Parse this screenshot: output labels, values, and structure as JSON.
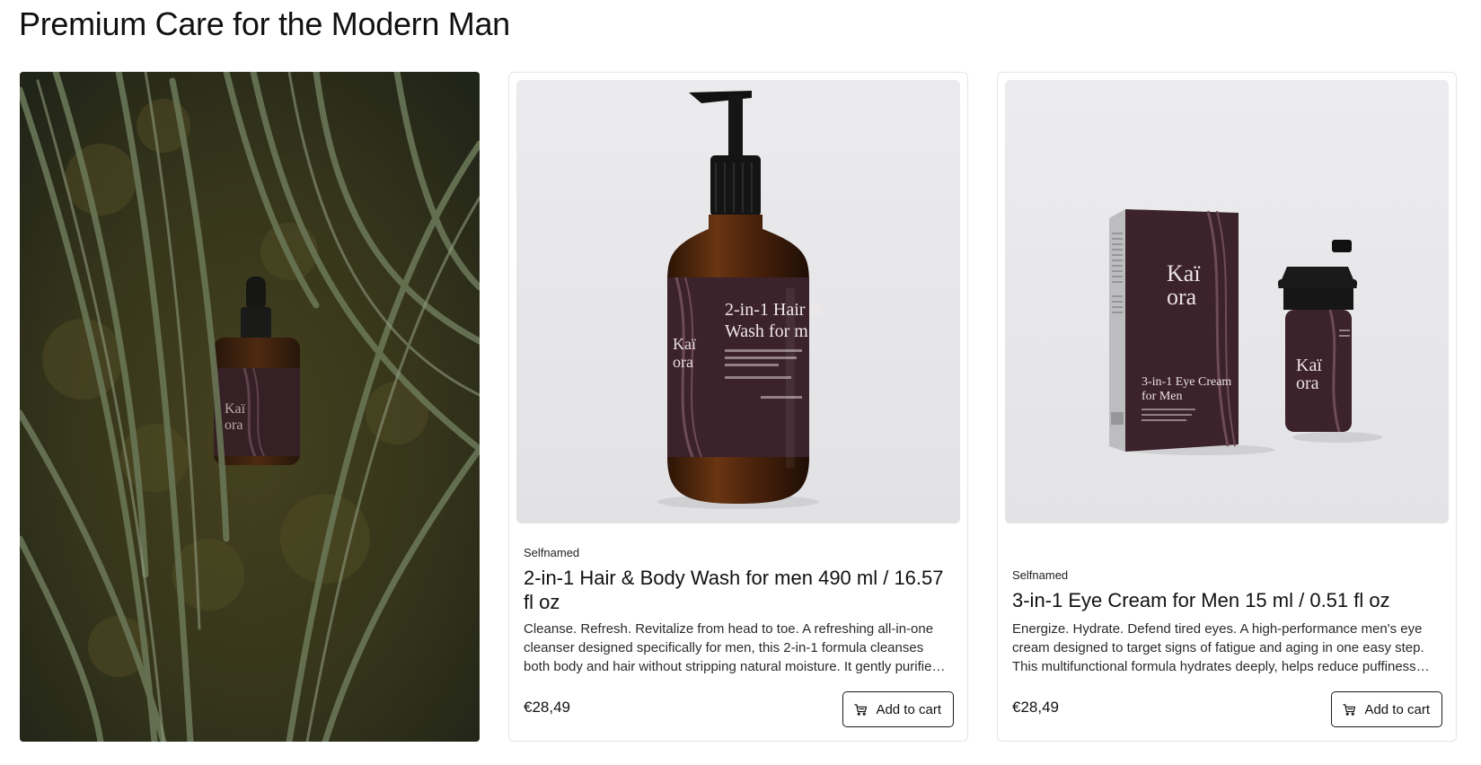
{
  "page": {
    "title": "Premium Care for the Modern Man"
  },
  "hero": {
    "label_brand": "Kaï",
    "label_brand2": "ora"
  },
  "products": [
    {
      "brand": "Selfnamed",
      "name": "2-in-1 Hair & Body Wash for men 490 ml / 16.57 fl oz",
      "description": "Cleanse. Refresh. Revitalize from head to toe. A refreshing all-in-one cleanser designed specifically for men, this 2-in-1 formula cleanses both body and hair without stripping natural moisture. It gently purifies the skin and scalp while leaving a fresh feeling.",
      "price": "€28,49",
      "button_label": "Add to cart",
      "button_icon": "cart-icon",
      "image_label_line1": "2-in-1 Hair &",
      "image_label_line2": "Wash for m"
    },
    {
      "brand": "Selfnamed",
      "name": "3-in-1 Eye Cream for Men 15 ml / 0.51 fl oz",
      "description": "Energize. Hydrate. Defend tired eyes. A high-performance men's eye cream designed to target signs of fatigue and aging in one easy step. This multifunctional formula hydrates deeply, helps reduce puffiness and dark circles.",
      "price": "€28,49",
      "button_label": "Add to cart",
      "button_icon": "cart-icon",
      "image_label_line1": "3-in-1 Eye Cream",
      "image_label_line2": "for Men"
    }
  ],
  "colors": {
    "label_plum": "#3b222b",
    "amber_glass": "#5a2e12",
    "moss": "#3d3f22",
    "card_image_bg": "#e9e9eb"
  }
}
